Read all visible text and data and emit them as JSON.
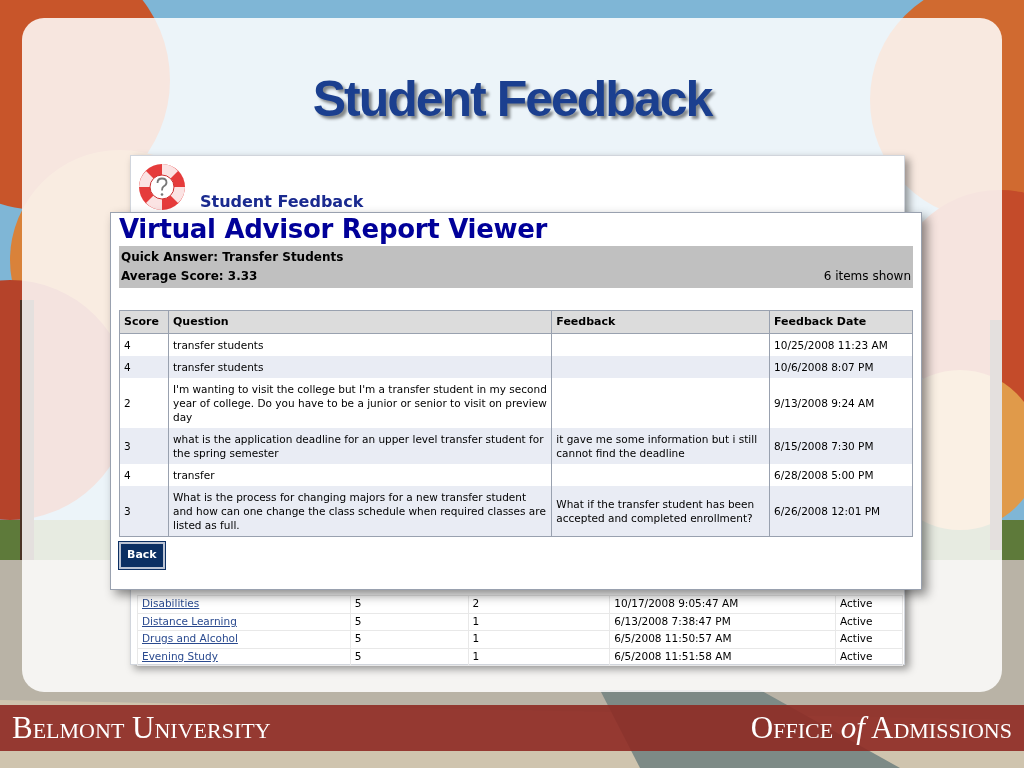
{
  "slide": {
    "title": "Student Feedback"
  },
  "back_screenshot": {
    "heading": "Student Feedback",
    "rows": [
      {
        "topic": "Disabilities",
        "column_2": "5",
        "column_3": "2",
        "column_4": "10/17/2008 9:05:47 AM",
        "column_5": "Active"
      },
      {
        "topic": "Distance Learning",
        "column_2": "5",
        "column_3": "1",
        "column_4": "6/13/2008 7:38:47 PM",
        "column_5": "Active"
      },
      {
        "topic": "Drugs and Alcohol",
        "column_2": "5",
        "column_3": "1",
        "column_4": "6/5/2008 11:50:57 AM",
        "column_5": "Active"
      },
      {
        "topic": "Evening Study",
        "column_2": "5",
        "column_3": "1",
        "column_4": "6/5/2008 11:51:58 AM",
        "column_5": "Active"
      }
    ]
  },
  "report_viewer": {
    "title": "Virtual Advisor Report Viewer",
    "quick_answer": "Quick Answer: Transfer Students",
    "average_score": "Average Score: 3.33",
    "items_shown": "6 items shown",
    "columns": [
      "Score",
      "Question",
      "Feedback",
      "Feedback Date"
    ],
    "rows": [
      {
        "score": "4",
        "question": "transfer students",
        "date": "10/25/2008 11:23 AM"
      },
      {
        "score": "4",
        "question": "transfer students",
        "date": "10/6/2008 8:07 PM"
      },
      {
        "score": "2",
        "question": "I'm wanting to visit the college but I'm a transfer student in my second year of college. Do you have to be a junior or senior to visit on preview day",
        "date": "9/13/2008 9:24 AM"
      },
      {
        "score": "3",
        "question": "what is the application deadline for an upper level transfer student for the spring semester",
        "feedback": "it gave me some information but i still cannot find the deadline",
        "date": "8/15/2008 7:30 PM"
      },
      {
        "score": "4",
        "question": "transfer",
        "date": "6/28/2008 5:00 PM"
      },
      {
        "score": "3",
        "question": "What is the process for changing majors for a new transfer student and how can one change the class schedule when required classes are listed as full.",
        "feedback": "What if the transfer student has been accepted and completed enrollment?",
        "date": "6/26/2008 12:01 PM"
      }
    ],
    "back_button": "Back"
  },
  "footer": {
    "left": "Belmont University",
    "right": "Office *of* Admissions"
  }
}
